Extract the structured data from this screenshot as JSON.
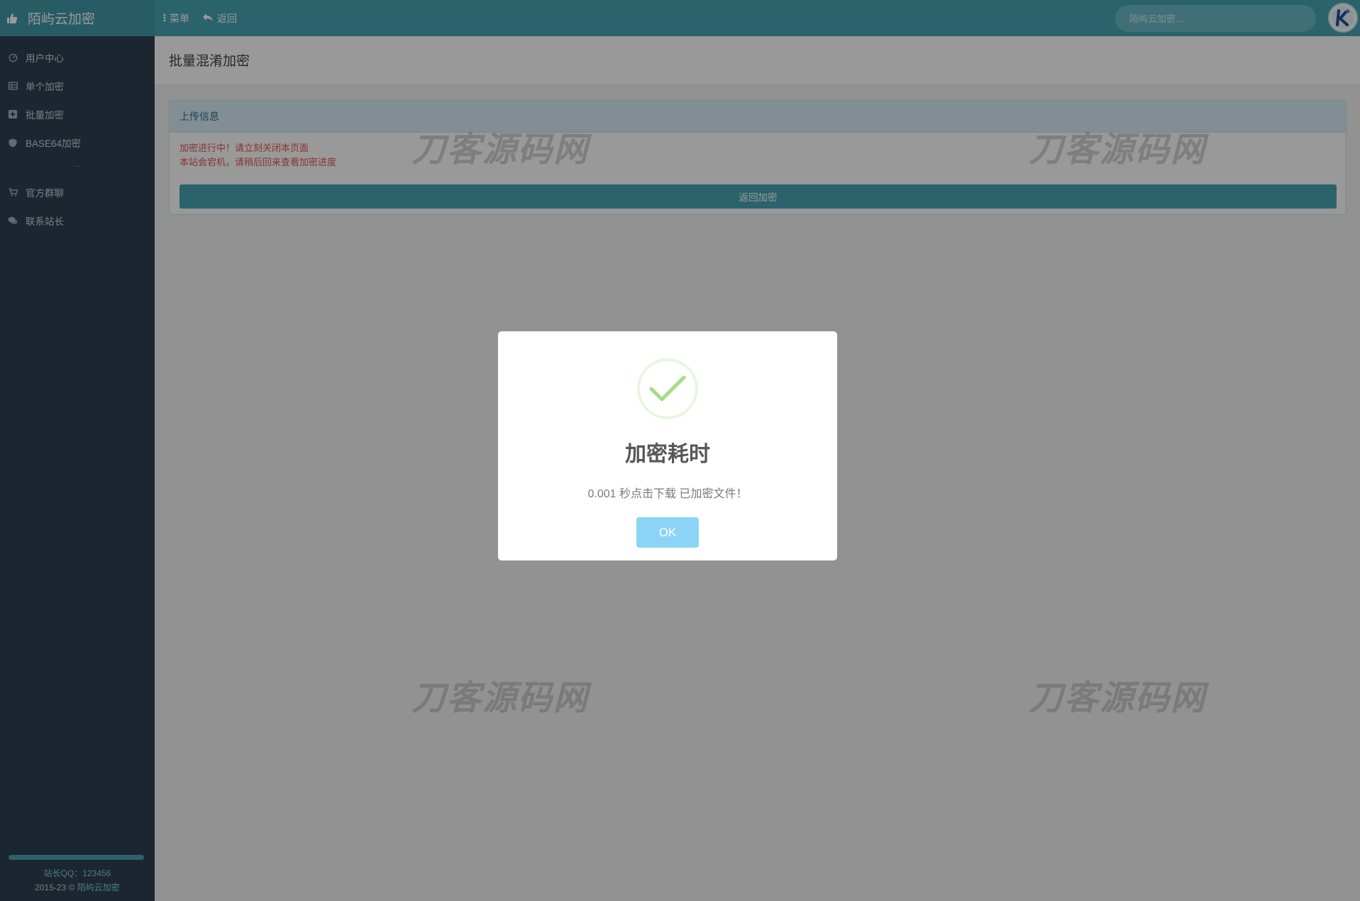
{
  "header": {
    "brand": "陌屿云加密",
    "menu_label": "菜单",
    "back_label": "返回",
    "search_placeholder": "陌屿云加密...",
    "accent_color": "#49a6b5"
  },
  "sidebar": {
    "items": [
      {
        "label": "用户中心",
        "icon": "dashboard-icon"
      },
      {
        "label": "单个加密",
        "icon": "table-icon"
      },
      {
        "label": "批量加密",
        "icon": "plus-square-icon"
      },
      {
        "label": "BASE64加密",
        "icon": "shield-icon"
      },
      {
        "label": "官方群聊",
        "icon": "cart-icon"
      },
      {
        "label": "联系站长",
        "icon": "comments-icon"
      }
    ],
    "footer": {
      "qq": "站长QQ：123456",
      "copyright_prefix": "2015-23 © ",
      "copyright_link": "陌屿云加密"
    }
  },
  "main": {
    "page_title": "批量混淆加密",
    "panel": {
      "heading": "上传信息",
      "message_line1": "加密进行中！请立刻关闭本页面",
      "message_line2": "本站会宕机，请稍后回来查看加密进度",
      "return_button": "返回加密"
    },
    "watermark": "刀客源码网"
  },
  "modal": {
    "title": "加密耗时",
    "text": "0.001 秒点击下载 已加密文件！",
    "ok_label": "OK",
    "icon": "success-check-icon",
    "ok_color": "#8cd4f5"
  }
}
